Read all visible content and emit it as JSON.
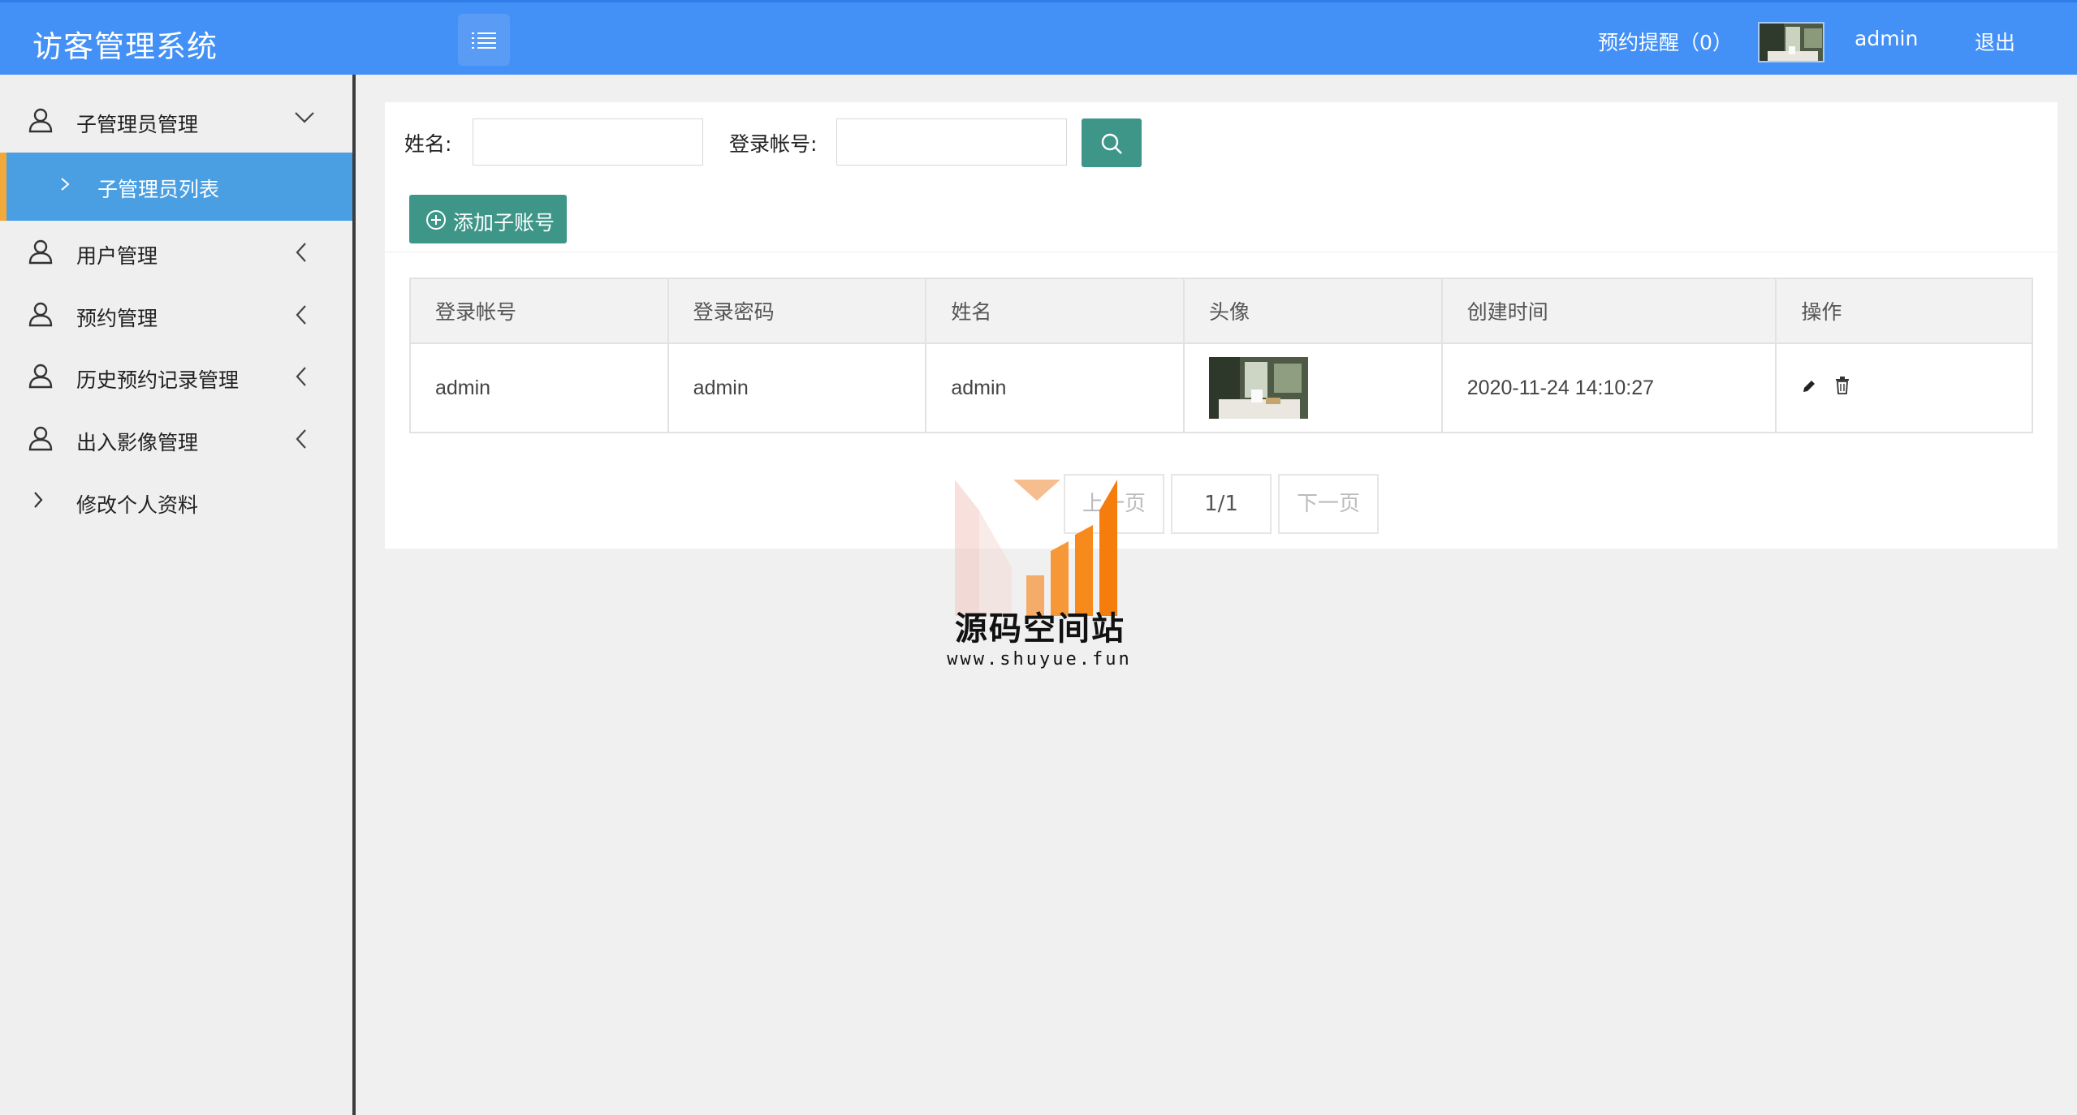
{
  "header": {
    "app_title": "访客管理系统",
    "reminder": "预约提醒（0）",
    "username": "admin",
    "logout": "退出",
    "menu_icon": "list-icon"
  },
  "sidebar": {
    "items": [
      {
        "label": "子管理员管理",
        "icon": "user-icon",
        "state": "expanded"
      },
      {
        "label": "用户管理",
        "icon": "user-icon"
      },
      {
        "label": "预约管理",
        "icon": "user-icon"
      },
      {
        "label": "历史预约记录管理",
        "icon": "user-icon"
      },
      {
        "label": "出入影像管理",
        "icon": "user-icon"
      },
      {
        "label": "修改个人资料",
        "icon": "chevron-right-icon"
      }
    ],
    "active_sub": {
      "label": "子管理员列表"
    }
  },
  "filters": {
    "name_label": "姓名:",
    "name_value": "",
    "account_label": "登录帐号:",
    "account_value": ""
  },
  "toolbar": {
    "add_label": "添加子账号"
  },
  "table": {
    "headers": [
      "登录帐号",
      "登录密码",
      "姓名",
      "头像",
      "创建时间",
      "操作"
    ],
    "rows": [
      {
        "account": "admin",
        "password": "admin",
        "name": "admin",
        "created": "2020-11-24 14:10:27"
      }
    ]
  },
  "pager": {
    "prev": "上一页",
    "current": "1/1",
    "next": "下一页"
  },
  "watermark": {
    "title": "源码空间站",
    "url": "www.shuyue.fun"
  },
  "colors": {
    "header": "#4390f7",
    "active_sub": "#4a9fe3",
    "active_marker": "#f2a93b",
    "primary_button": "#3e9688"
  }
}
